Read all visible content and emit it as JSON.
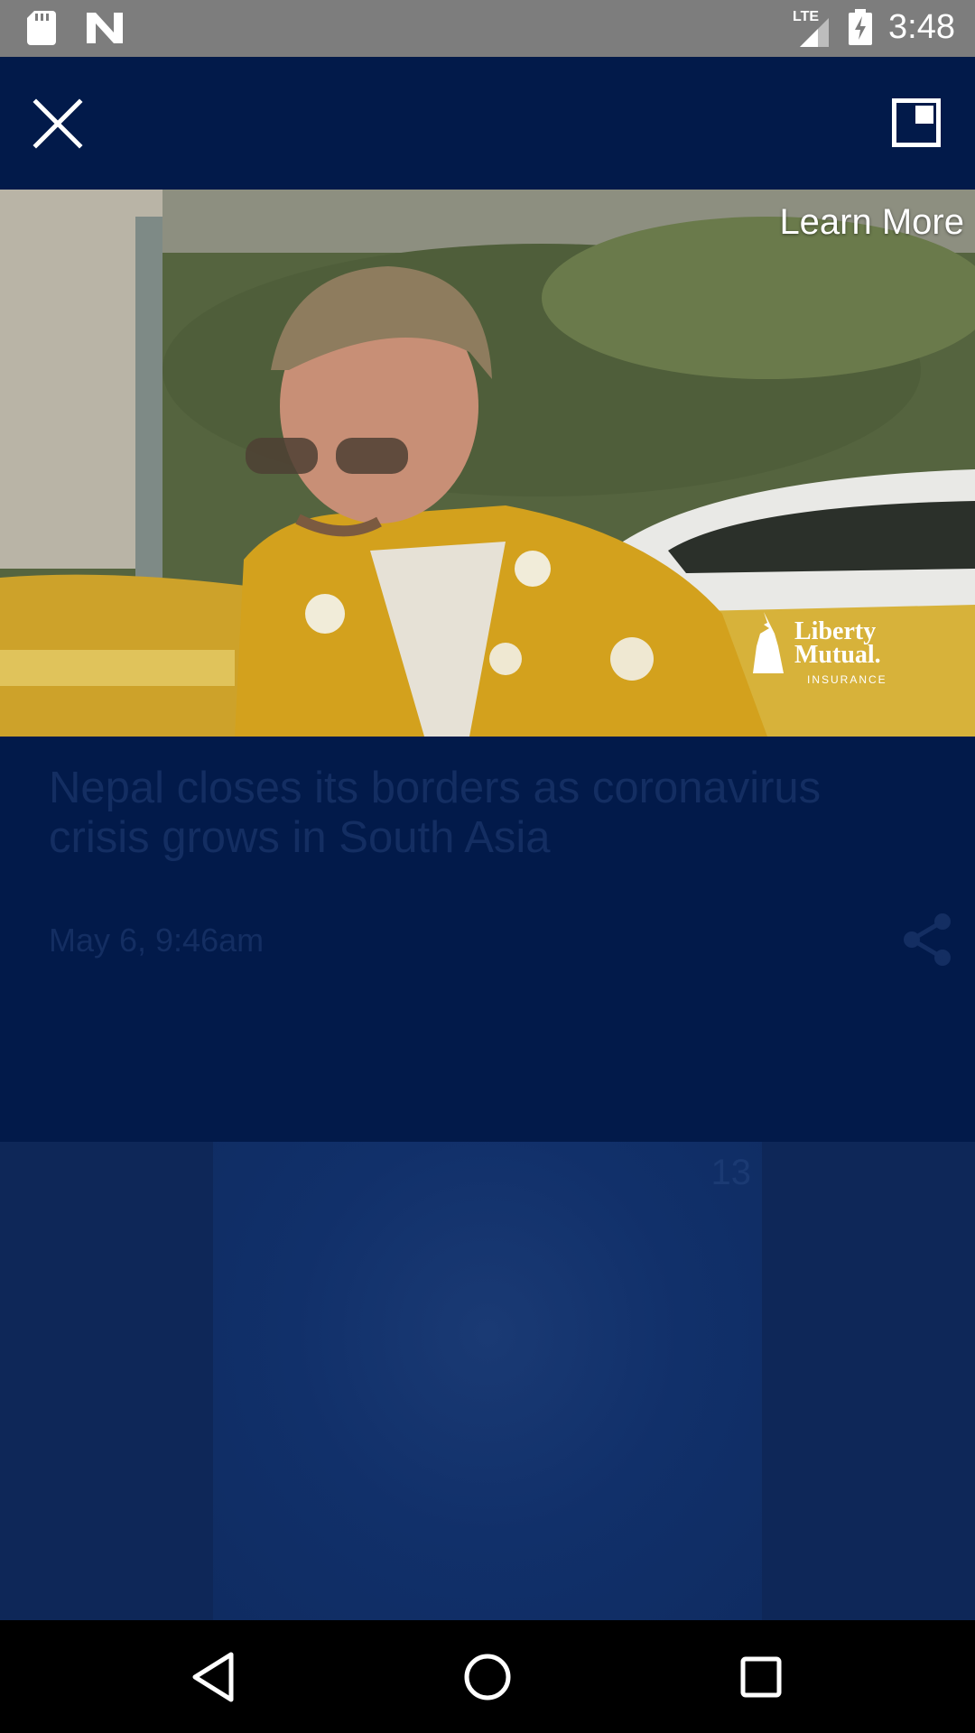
{
  "status_bar": {
    "time": "3:48",
    "network_label": "LTE",
    "icons": [
      "sd-card-icon",
      "n-app-icon",
      "signal-icon",
      "battery-charging-icon"
    ]
  },
  "app_bar": {
    "icons": [
      "close-icon",
      "picture-in-picture-icon"
    ]
  },
  "video": {
    "cta_label": "Learn More",
    "brand_line1": "Liberty",
    "brand_line2": "Mutual.",
    "brand_line3": "INSURANCE"
  },
  "article": {
    "headline": "Nepal closes its borders as coronavirus crisis grows in South Asia",
    "date": "May 6, 9:46am",
    "share_icon": "share-icon"
  },
  "next_item": {
    "badge": "13"
  },
  "nav_bar": {
    "icons": [
      "back-icon",
      "home-icon",
      "recents-icon"
    ]
  },
  "colors": {
    "status_bar": "#7d7d7d",
    "app_bar": "#021a4a",
    "dim_text": "#142e62",
    "nav_bar": "#000000"
  }
}
